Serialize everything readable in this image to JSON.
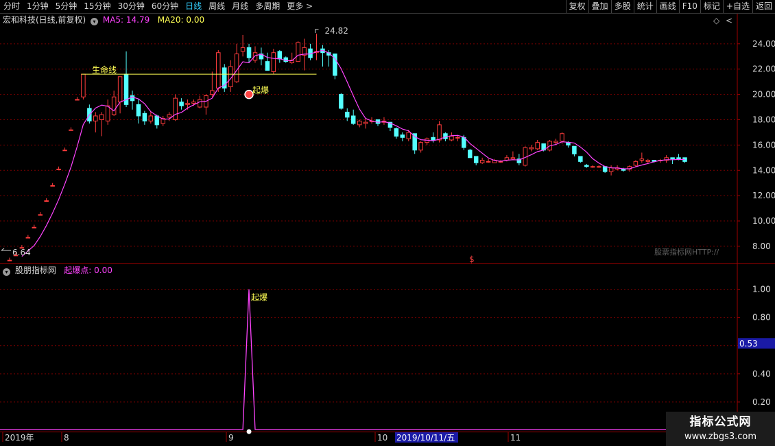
{
  "toolbar": {
    "periods": [
      "分时",
      "1分钟",
      "5分钟",
      "15分钟",
      "30分钟",
      "60分钟",
      "日线",
      "周线",
      "月线",
      "多周期",
      "更多 >"
    ],
    "active_period": "日线",
    "buttons": [
      "复权",
      "叠加",
      "多股",
      "统计",
      "画线",
      "F10",
      "标记",
      "+自选",
      "返回"
    ]
  },
  "header": {
    "stock": "宏和科技(日线,前复权)",
    "ma5_label": "MA5: 14.79",
    "ma20_label": "MA20: 0.00",
    "diamond": "◇",
    "scroll_arrow": "<"
  },
  "sub_header": {
    "name": "股朋指标网",
    "indicator": "起爆点: 0.00"
  },
  "colors": {
    "up": "#ff3c3c",
    "down": "#54ffff",
    "ma5": "#ff44ff",
    "ma20": "#ffff55",
    "grid": "#7a0000",
    "frame": "#a00000",
    "yellow": "#ffff55"
  },
  "annotations": {
    "life_line": "生命线",
    "qibao": "起爆",
    "high_label": "24.82",
    "low_label": "6.64",
    "dollar": "$",
    "qibao_sub": "起爆"
  },
  "watermark": "股票指标网HTTP://",
  "cursor_value": "0.53",
  "date_axis": [
    "2019年",
    "8",
    "9",
    "10",
    "11"
  ],
  "date_highlight": "2019/10/11/五",
  "logo": {
    "line1": "指标公式网",
    "line2": "www.zbgs3.com"
  },
  "chart_data": {
    "type": "candlestick",
    "main_ylim": [
      6.64,
      25.4
    ],
    "main_yticks": [
      8,
      10,
      12,
      14,
      16,
      18,
      20,
      22,
      24
    ],
    "sub_ylim": [
      0,
      1.1
    ],
    "sub_yticks": [
      0.2,
      0.4,
      0.6,
      0.8,
      1.0
    ],
    "candles": [
      [
        6.9,
        6.9,
        6.9,
        7.1
      ],
      [
        7.3,
        7.3,
        7.3,
        7.5
      ],
      [
        7.9,
        7.9,
        7.9,
        8.1
      ],
      [
        8.7,
        8.7,
        8.7,
        8.9
      ],
      [
        9.5,
        9.5,
        9.5,
        9.7
      ],
      [
        10.5,
        10.5,
        10.5,
        10.7
      ],
      [
        11.6,
        11.6,
        11.6,
        11.8
      ],
      [
        12.8,
        12.8,
        12.8,
        13.0
      ],
      [
        14.1,
        14.1,
        14.1,
        14.3
      ],
      [
        15.6,
        15.6,
        15.6,
        15.8
      ],
      [
        17.2,
        17.2,
        17.2,
        17.4
      ],
      [
        19.6,
        19.6,
        19.6,
        19.8
      ],
      [
        19.8,
        21.6,
        19.6,
        21.6
      ],
      [
        18.9,
        17.9,
        17.7,
        19.2
      ],
      [
        17.9,
        18.3,
        17.0,
        18.6
      ],
      [
        18.0,
        18.4,
        16.7,
        18.6
      ],
      [
        17.9,
        19.1,
        17.6,
        19.6
      ],
      [
        18.4,
        19.8,
        18.3,
        20.3
      ],
      [
        19.4,
        21.4,
        18.5,
        21.4
      ],
      [
        21.6,
        19.2,
        19.0,
        23.4
      ],
      [
        19.9,
        19.5,
        18.8,
        20.3
      ],
      [
        19.2,
        18.3,
        17.7,
        19.6
      ],
      [
        18.5,
        17.9,
        17.6,
        18.7
      ],
      [
        17.9,
        18.3,
        17.7,
        18.7
      ],
      [
        18.3,
        17.6,
        17.3,
        18.4
      ],
      [
        17.7,
        18.1,
        17.5,
        18.3
      ],
      [
        18.2,
        18.4,
        17.9,
        18.6
      ],
      [
        18.0,
        19.7,
        17.9,
        20.0
      ],
      [
        19.4,
        19.1,
        18.8,
        19.7
      ],
      [
        19.2,
        19.3,
        18.8,
        19.6
      ],
      [
        19.3,
        19.4,
        19.1,
        19.6
      ],
      [
        19.0,
        19.6,
        18.9,
        19.9
      ],
      [
        19.0,
        19.9,
        18.4,
        20.0
      ],
      [
        20.0,
        20.3,
        19.8,
        21.8
      ],
      [
        20.5,
        23.3,
        20.2,
        23.5
      ],
      [
        22.1,
        20.5,
        20.2,
        22.4
      ],
      [
        20.6,
        22.2,
        20.2,
        22.7
      ],
      [
        21.0,
        23.2,
        20.9,
        24.0
      ],
      [
        23.4,
        23.7,
        23.0,
        24.7
      ],
      [
        23.7,
        22.9,
        22.5,
        24.0
      ],
      [
        22.7,
        23.3,
        22.5,
        23.8
      ],
      [
        23.2,
        22.8,
        22.3,
        23.7
      ],
      [
        22.6,
        21.9,
        21.9,
        23.3
      ],
      [
        21.8,
        23.3,
        21.6,
        23.6
      ],
      [
        23.4,
        22.8,
        22.5,
        23.5
      ],
      [
        22.9,
        22.6,
        22.5,
        23.0
      ],
      [
        22.5,
        22.7,
        22.4,
        23.3
      ],
      [
        22.6,
        24.1,
        22.6,
        24.2
      ],
      [
        23.1,
        23.7,
        21.9,
        24.4
      ],
      [
        23.6,
        22.9,
        22.7,
        24.0
      ],
      [
        23.3,
        23.4,
        22.7,
        24.8
      ],
      [
        23.6,
        23.3,
        22.2,
        23.9
      ],
      [
        23.3,
        23.1,
        22.2,
        23.5
      ],
      [
        23.2,
        21.5,
        21.2,
        23.2
      ],
      [
        20.0,
        18.9,
        18.8,
        20.1
      ],
      [
        18.6,
        18.2,
        17.9,
        18.9
      ],
      [
        18.3,
        17.7,
        17.6,
        18.8
      ],
      [
        17.6,
        17.9,
        17.4,
        18.0
      ],
      [
        17.7,
        17.8,
        17.3,
        18.1
      ],
      [
        17.9,
        17.9,
        17.7,
        18.2
      ],
      [
        18.0,
        17.7,
        17.5,
        18.0
      ],
      [
        17.8,
        17.9,
        17.6,
        18.2
      ],
      [
        17.8,
        17.4,
        17.1,
        17.8
      ],
      [
        17.3,
        16.7,
        16.5,
        17.4
      ],
      [
        16.8,
        16.6,
        16.3,
        17.0
      ],
      [
        16.5,
        17.0,
        16.3,
        17.2
      ],
      [
        16.9,
        15.6,
        15.3,
        16.9
      ],
      [
        15.6,
        16.2,
        15.4,
        16.3
      ],
      [
        16.2,
        16.5,
        16.0,
        16.6
      ],
      [
        16.6,
        16.4,
        16.2,
        17.0
      ],
      [
        16.4,
        17.6,
        16.2,
        17.9
      ],
      [
        16.9,
        16.5,
        16.3,
        17.0
      ],
      [
        16.4,
        16.7,
        16.3,
        17.0
      ],
      [
        16.6,
        16.6,
        16.3,
        16.8
      ],
      [
        16.6,
        15.8,
        15.6,
        16.8
      ],
      [
        15.6,
        15.0,
        15.0,
        15.7
      ],
      [
        15.1,
        14.6,
        14.4,
        15.1
      ],
      [
        14.6,
        14.8,
        14.5,
        15.0
      ],
      [
        14.7,
        14.7,
        14.6,
        14.9
      ],
      [
        14.6,
        14.8,
        14.6,
        14.9
      ],
      [
        14.7,
        14.7,
        14.6,
        14.8
      ],
      [
        14.8,
        15.0,
        14.7,
        15.2
      ],
      [
        14.9,
        15.0,
        14.8,
        15.5
      ],
      [
        14.9,
        14.6,
        14.4,
        15.3
      ],
      [
        14.4,
        15.8,
        14.3,
        15.9
      ],
      [
        15.7,
        15.8,
        15.5,
        16.0
      ],
      [
        15.7,
        16.2,
        15.6,
        16.4
      ],
      [
        16.1,
        15.6,
        15.5,
        16.1
      ],
      [
        15.6,
        16.3,
        15.5,
        16.4
      ],
      [
        16.2,
        16.3,
        16.0,
        16.5
      ],
      [
        16.3,
        16.9,
        16.1,
        17.0
      ],
      [
        16.2,
        16.0,
        15.8,
        16.3
      ],
      [
        15.9,
        15.3,
        15.1,
        15.9
      ],
      [
        15.1,
        14.7,
        14.6,
        15.1
      ],
      [
        14.4,
        14.3,
        14.2,
        14.5
      ],
      [
        14.3,
        14.3,
        14.2,
        14.4
      ],
      [
        14.3,
        14.3,
        14.2,
        14.4
      ],
      [
        14.3,
        13.9,
        13.8,
        14.3
      ],
      [
        13.9,
        14.2,
        13.6,
        14.4
      ],
      [
        14.1,
        14.2,
        14.0,
        14.4
      ],
      [
        14.1,
        14.0,
        13.9,
        14.2
      ],
      [
        14.1,
        14.3,
        13.9,
        14.4
      ],
      [
        14.4,
        14.7,
        14.3,
        14.8
      ],
      [
        14.8,
        14.9,
        14.6,
        15.4
      ],
      [
        14.7,
        14.8,
        14.5,
        14.9
      ],
      [
        14.8,
        14.7,
        14.6,
        14.8
      ],
      [
        14.8,
        14.8,
        14.6,
        14.9
      ],
      [
        14.8,
        15.0,
        14.6,
        15.2
      ],
      [
        15.0,
        14.9,
        14.5,
        15.0
      ],
      [
        15.0,
        14.9,
        14.8,
        15.3
      ],
      [
        15.0,
        14.7,
        14.6,
        15.0
      ]
    ],
    "ma5_start": 7.2,
    "life_line_value": 21.6,
    "signal_value": 1.0
  }
}
